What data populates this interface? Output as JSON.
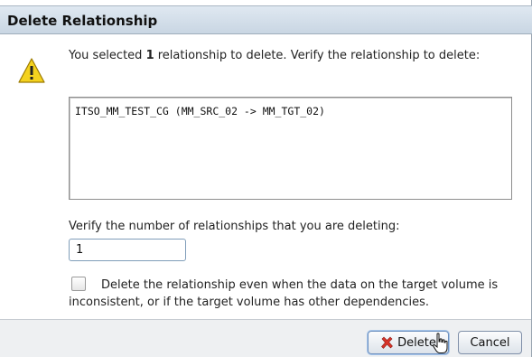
{
  "dialog": {
    "title": "Delete Relationship",
    "message_prefix": "You selected ",
    "selected_count": "1",
    "message_suffix": " relationship to delete. Verify the relationship to delete:",
    "relationships": [
      "ITSO_MM_TEST_CG (MM_SRC_02 -> MM_TGT_02)"
    ],
    "verify_label": "Verify the number of relationships that you are deleting:",
    "verify_value": "1",
    "force_label": "Delete the relationship even when the data on the target volume is inconsistent, or if the target volume has other dependencies.",
    "force_checked": false
  },
  "buttons": {
    "delete_label": "Delete",
    "cancel_label": "Cancel"
  },
  "icons": {
    "warning": "warning-icon",
    "delete": "red-x-icon",
    "cursor": "hand-pointer-icon"
  },
  "colors": {
    "titlebar": "#c9d6e3",
    "warning": "#f4d21f",
    "delete_x": "#d8352a",
    "footer": "#eef0f2"
  }
}
